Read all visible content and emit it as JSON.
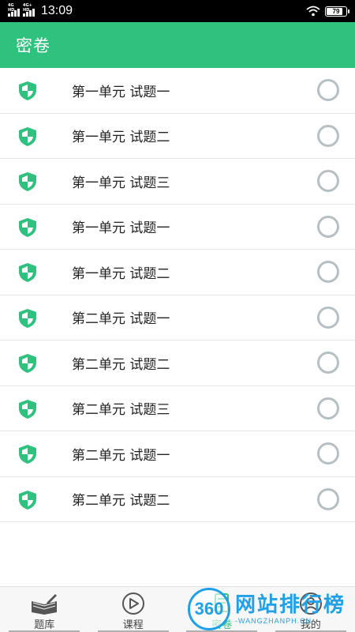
{
  "status_bar": {
    "network_1": "4G HD",
    "network_2": "4G+ HD",
    "time": "13:09",
    "battery": "79"
  },
  "app_bar": {
    "title": "密卷"
  },
  "papers": [
    {
      "title": "第一单元 试题一"
    },
    {
      "title": "第一单元 试题二"
    },
    {
      "title": "第一单元 试题三"
    },
    {
      "title": "第一单元 试题一"
    },
    {
      "title": "第一单元 试题二"
    },
    {
      "title": "第二单元 试题一"
    },
    {
      "title": "第二单元 试题二"
    },
    {
      "title": "第二单元 试题三"
    },
    {
      "title": "第二单元 试题一"
    },
    {
      "title": "第二单元 试题二"
    }
  ],
  "tabs": [
    {
      "label": "题库",
      "icon": "book-pen-icon"
    },
    {
      "label": "课程",
      "icon": "play-circle-icon"
    },
    {
      "label": "密卷",
      "icon": "paper-icon"
    },
    {
      "label": "我的",
      "icon": "user-icon"
    }
  ],
  "watermark": {
    "badge": "360",
    "main": "网站排行榜",
    "sub": "-WANGZHANPH.CN-"
  },
  "colors": {
    "accent": "#2ec27e",
    "radio_border": "#b6c0c4",
    "watermark": "#1fa0e8"
  }
}
